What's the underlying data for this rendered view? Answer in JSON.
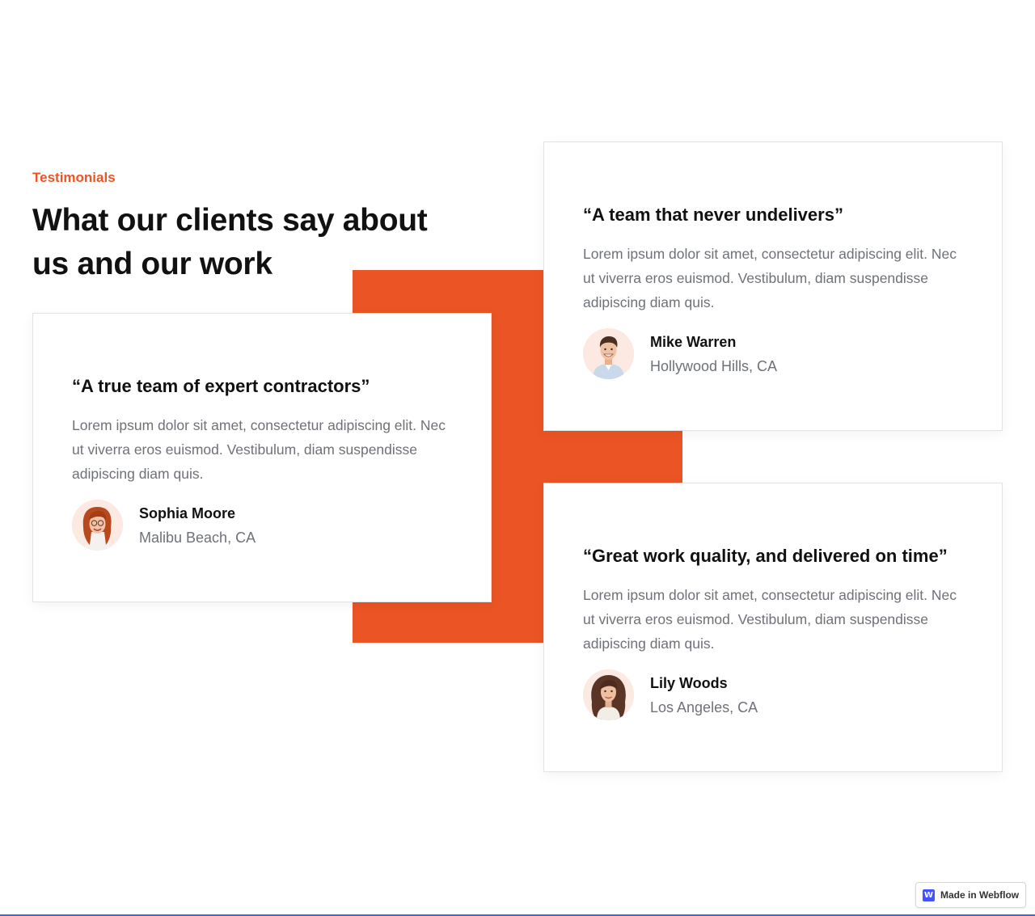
{
  "section": {
    "eyebrow": "Testimonials",
    "title": "What our clients say about us and our work"
  },
  "testimonials": [
    {
      "quote": "“A true team of expert contractors”",
      "body": "Lorem ipsum dolor sit amet, consectetur adipiscing elit. Nec ut viverra eros euismod. Vestibulum, diam suspendisse adipiscing diam quis.",
      "name": "Sophia Moore",
      "location": "Malibu Beach, CA"
    },
    {
      "quote": "“A team that never undelivers”",
      "body": "Lorem ipsum dolor sit amet, consectetur adipiscing elit. Nec ut viverra eros euismod. Vestibulum, diam suspendisse adipiscing diam quis.",
      "name": "Mike Warren",
      "location": "Hollywood Hills, CA"
    },
    {
      "quote": "“Great work quality, and delivered on time”",
      "body": "Lorem ipsum dolor sit amet, consectetur adipiscing elit. Nec ut viverra eros euismod. Vestibulum, diam suspendisse adipiscing diam quis.",
      "name": "Lily Woods",
      "location": "Los Angeles, CA"
    }
  ],
  "badge": {
    "logo": "W",
    "label": "Made in Webflow"
  },
  "colors": {
    "accent": "#eb5424",
    "heading": "#111111",
    "body_text": "#6e7177",
    "avatar_bg": "#fbe9e2",
    "webflow_blue": "#4353ff"
  }
}
